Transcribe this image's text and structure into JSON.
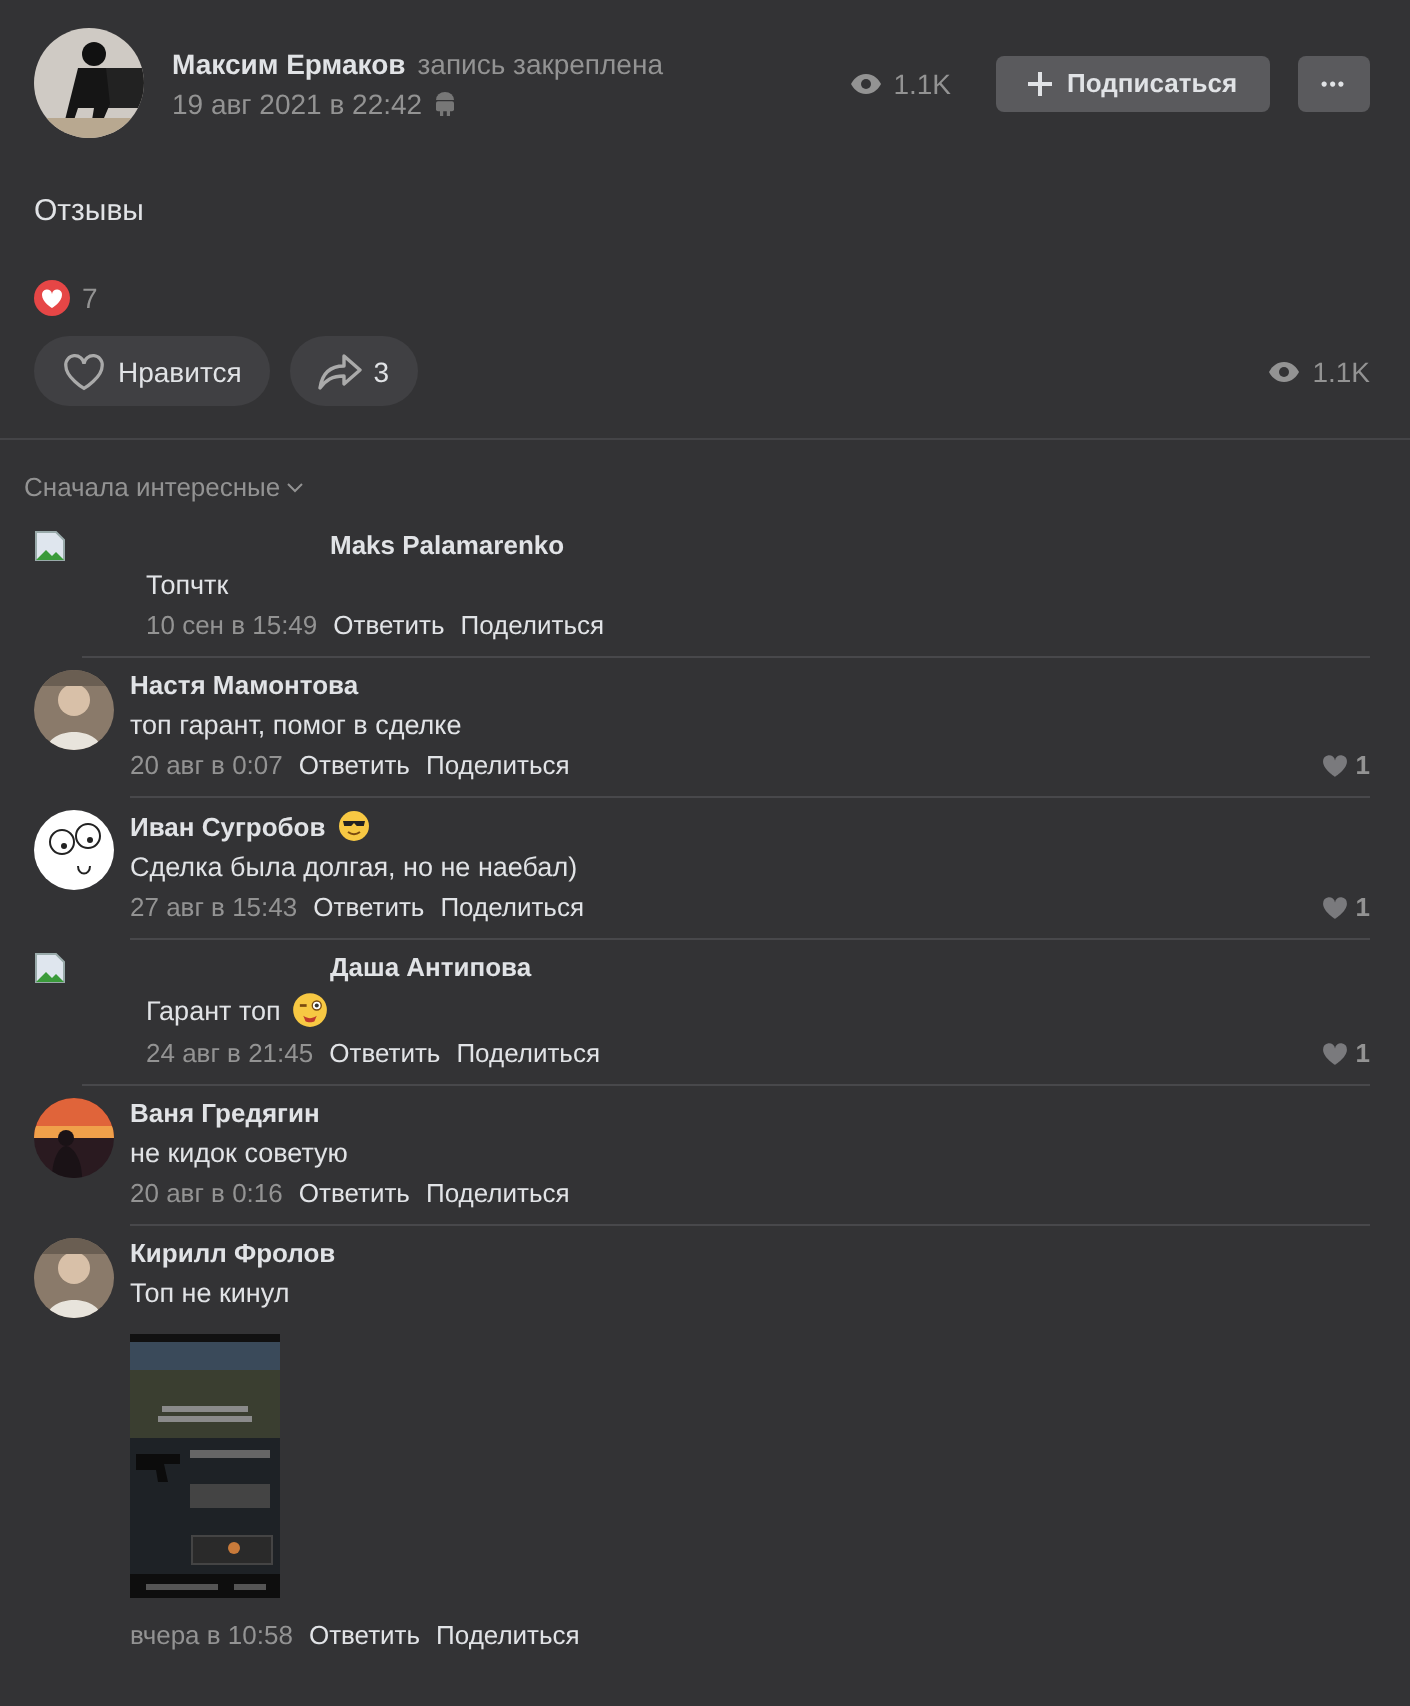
{
  "post": {
    "author": "Максим Ермаков",
    "note": "запись закреплена",
    "date": "19 авг 2021 в 22:42",
    "views": "1.1K",
    "subscribe": "Подписаться",
    "more": "•••",
    "text": "Отзывы",
    "reactions": "7",
    "like_button": "Нравится",
    "shares": "3",
    "views_bottom": "1.1K"
  },
  "sort": "Сначала интересные",
  "comments": [
    {
      "author": "Maks Palamarenko",
      "avatar": {
        "kind": "broken"
      },
      "text": "Топчтк",
      "date": "10 сен в 15:49",
      "reply": "Ответить",
      "share": "Поделиться"
    },
    {
      "author": "Настя Мамонтова",
      "text": "топ гарант, помог в сделке",
      "date": "20 авг в 0:07",
      "reply": "Ответить",
      "share": "Поделиться",
      "likes": "1"
    },
    {
      "author": "Иван Сугробов",
      "avatar": {
        "kind": "drawing"
      },
      "name_emoji": {
        "kind": "sunglasses"
      },
      "text": "Сделка была долгая, но не наебал)",
      "date": "27 авг в 15:43",
      "reply": "Ответить",
      "share": "Поделиться",
      "likes": "1"
    },
    {
      "author": "Даша Антипова",
      "avatar": {
        "kind": "broken"
      },
      "text": "Гарант топ",
      "text_emoji": {
        "kind": "wink"
      },
      "date": "24 авг в 21:45",
      "reply": "Ответить",
      "share": "Поделиться",
      "likes": "1"
    },
    {
      "author": "Ваня Гредягин",
      "avatar": {
        "kind": "sunset"
      },
      "text": "не кидок советую",
      "date": "20 авг в 0:16",
      "reply": "Ответить",
      "share": "Поделиться"
    },
    {
      "author": "Кирилл Фролов",
      "text": "Топ не кинул",
      "date": "вчера в 10:58",
      "reply": "Ответить",
      "share": "Поделиться"
    }
  ]
}
